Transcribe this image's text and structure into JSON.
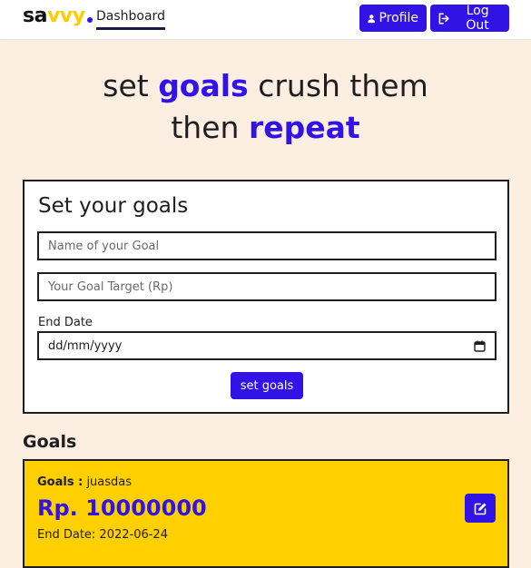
{
  "brand": {
    "prefix": "sa",
    "accent": "vvy",
    "colors": {
      "text": "#111111",
      "accent": "#ffcc00",
      "dot": "#3213e6"
    }
  },
  "nav": {
    "dashboard_label": "Dashboard",
    "profile_label": "Profile",
    "logout_label": "Log Out",
    "profile_icon": "user-icon",
    "logout_icon": "sign-out-icon"
  },
  "hero": {
    "line1_word1": "set",
    "line1_accent": "goals",
    "line1_rest": "crush them",
    "line2_word1": "then",
    "line2_accent": "repeat"
  },
  "form": {
    "title": "Set your goals",
    "goal_name_placeholder": "Name of your Goal",
    "goal_target_placeholder": "Your Goal Target (Rp)",
    "end_date_label": "End Date",
    "end_date_placeholder": "dd/mm/yyyy",
    "calendar_icon": "calendar-icon",
    "submit_label": "set goals"
  },
  "goals": {
    "heading": "Goals",
    "items": [
      {
        "label": "Goals :",
        "name": "juasdas",
        "amount": "Rp. 10000000",
        "end_date": "End Date: 2022-06-24",
        "edit_icon": "edit-icon"
      }
    ]
  },
  "colors": {
    "background": "#fdeee2",
    "primary": "#3213e6",
    "goal_card": "#ffd000",
    "border": "#1e1e1e"
  }
}
